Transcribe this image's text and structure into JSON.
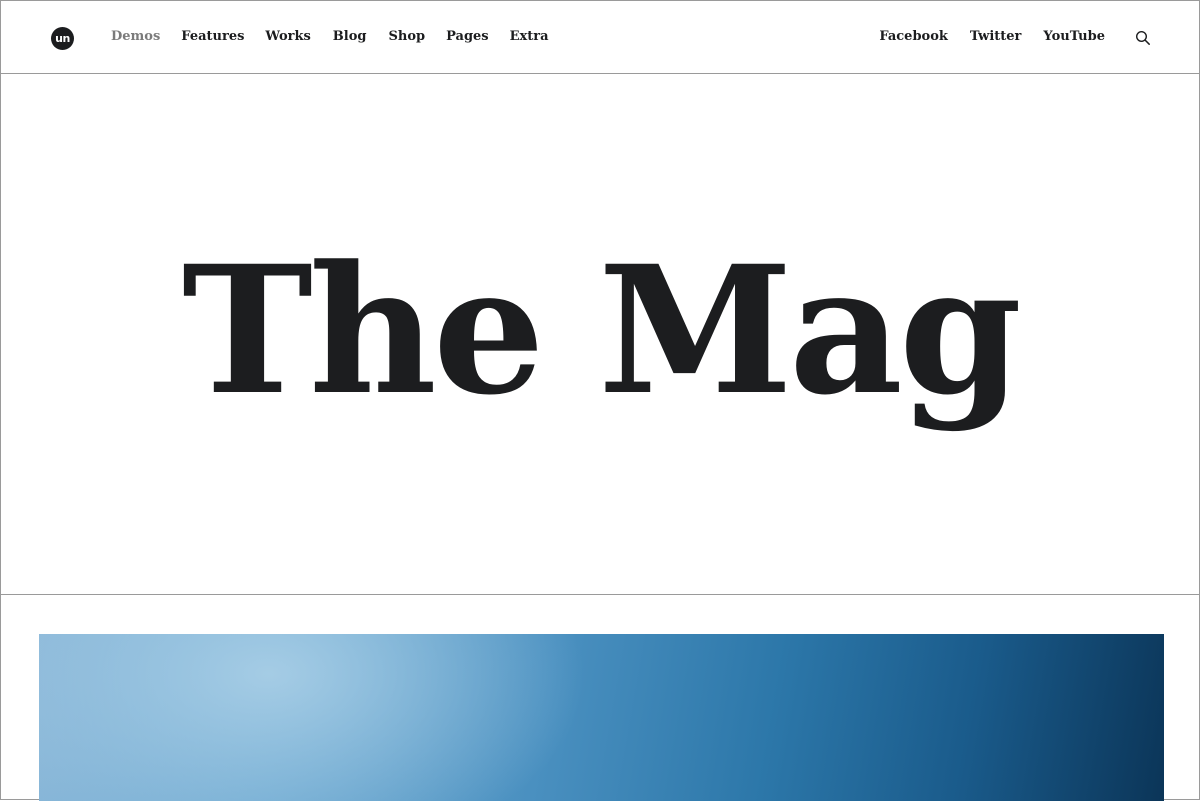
{
  "header": {
    "logo_text": "un",
    "nav_left": [
      {
        "label": "Demos",
        "active": true
      },
      {
        "label": "Features",
        "active": false
      },
      {
        "label": "Works",
        "active": false
      },
      {
        "label": "Blog",
        "active": false
      },
      {
        "label": "Shop",
        "active": false
      },
      {
        "label": "Pages",
        "active": false
      },
      {
        "label": "Extra",
        "active": false
      }
    ],
    "nav_right": [
      {
        "label": "Facebook"
      },
      {
        "label": "Twitter"
      },
      {
        "label": "YouTube"
      }
    ],
    "search_icon": "search-icon"
  },
  "hero": {
    "title": "The Mag"
  },
  "colors": {
    "text": "#1c1d1f",
    "muted_nav": "#7b7b7b",
    "divider": "#9a9a9a",
    "feature_light": "#8ab7d8",
    "feature_dark": "#0b3558"
  }
}
